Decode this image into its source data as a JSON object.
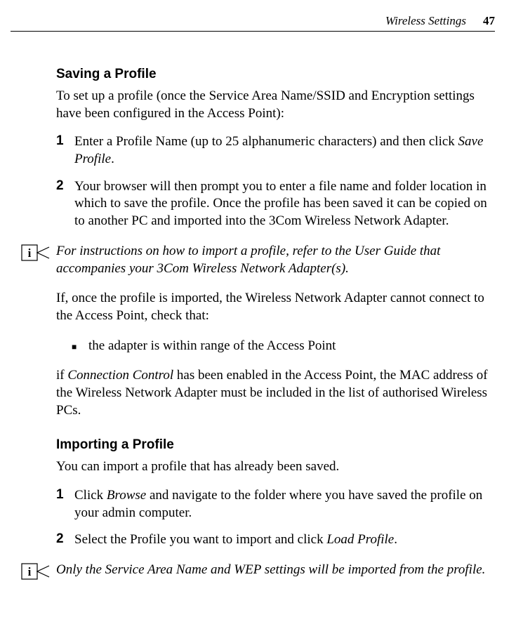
{
  "header": {
    "title": "Wireless Settings",
    "page": "47"
  },
  "section1": {
    "heading": "Saving a Profile",
    "intro": "To set up a profile (once the Service Area Name/SSID and Encryption settings have been configured in the Access Point):",
    "step1_num": "1",
    "step1_a": "Enter a Profile Name (up to 25 alphanumeric characters) and then click ",
    "step1_b": "Save Profile",
    "step1_c": ".",
    "step2_num": "2",
    "step2": "Your browser will then prompt you to enter a file name and folder location in which to save the profile. Once the profile has been saved it can be copied on to another PC and imported into the 3Com Wireless Network Adapter.",
    "info1": "For instructions on how to import a profile, refer to the User Guide that accompanies your 3Com Wireless Network Adapter(s).",
    "para1": "If, once the profile is imported, the Wireless Network Adapter cannot connect to the Access Point, check that:",
    "bullet1": "the adapter is within range of the Access Point",
    "para2_a": "if ",
    "para2_b": "Connection Control",
    "para2_c": " has been enabled in the Access Point, the MAC address of the Wireless Network Adapter must be included in the list of authorised Wireless PCs."
  },
  "section2": {
    "heading": "Importing a Profile",
    "intro": "You can import a profile that has already been saved.",
    "step1_num": "1",
    "step1_a": "Click ",
    "step1_b": "Browse",
    "step1_c": " and navigate to the folder where you have saved the profile on your admin computer.",
    "step2_num": "2",
    "step2_a": "Select the Profile you want to import and click ",
    "step2_b": "Load Profile",
    "step2_c": ".",
    "info2": "Only the Service Area Name and WEP settings will be imported from the profile."
  },
  "icons": {
    "info_name": "info-icon"
  }
}
